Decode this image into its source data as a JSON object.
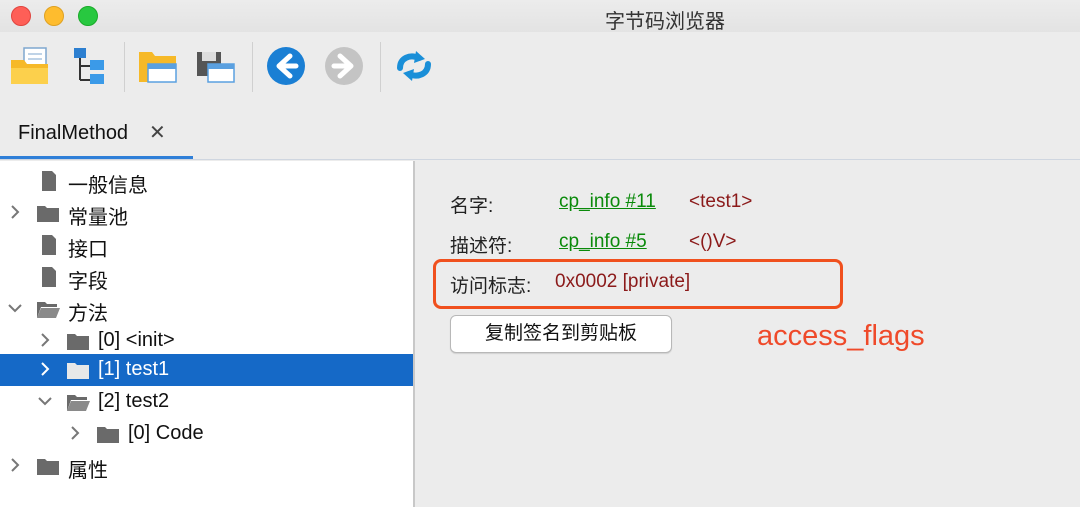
{
  "window": {
    "title": "字节码浏览器"
  },
  "colors": {
    "accent": "#2f7fd8",
    "selection": "#1569c7",
    "link": "#0a8a0a",
    "value": "#8b1a1a",
    "highlight": "#f0501e"
  },
  "toolbar": {
    "buttons": [
      {
        "name": "open-file-icon"
      },
      {
        "name": "tree-structure-icon"
      },
      {
        "name": "open-folder-icon"
      },
      {
        "name": "save-icon"
      },
      {
        "name": "back-arrow-icon"
      },
      {
        "name": "forward-arrow-icon"
      },
      {
        "name": "refresh-icon"
      }
    ]
  },
  "tab": {
    "label": "FinalMethod",
    "close": "✕"
  },
  "tree": {
    "items": [
      {
        "label": "一般信息"
      },
      {
        "label": "常量池"
      },
      {
        "label": "接口"
      },
      {
        "label": "字段"
      },
      {
        "label": "方法"
      },
      {
        "label": "[0] <init>"
      },
      {
        "label": "[1] test1"
      },
      {
        "label": "[2] test2"
      },
      {
        "label": "[0] Code"
      },
      {
        "label": "属性"
      }
    ]
  },
  "detail": {
    "name_label": "名字:",
    "name_link": "cp_info #11",
    "name_value": "<test1>",
    "desc_label": "描述符:",
    "desc_link": "cp_info #5",
    "desc_value": "<()V>",
    "flags_label": "访问标志:",
    "flags_value": "0x0002 [private]",
    "copy_button": "复制签名到剪贴板",
    "annotation": "access_flags"
  }
}
